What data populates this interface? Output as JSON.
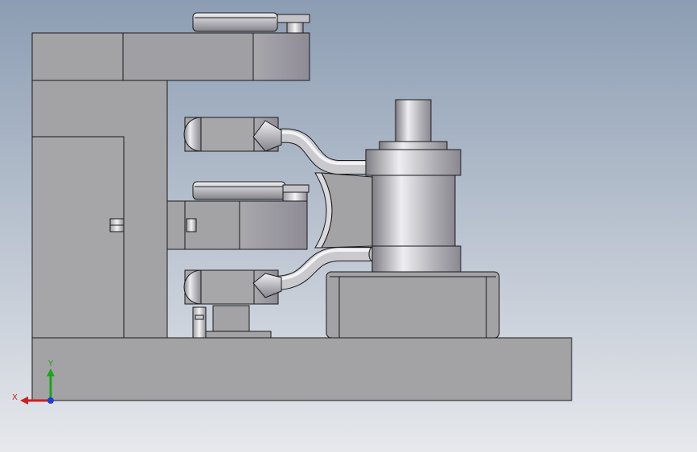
{
  "viewport": {
    "bg_top": "#8c9db3",
    "bg_bottom": "#e6e8ec"
  },
  "triad": {
    "x_label": "X",
    "y_label": "Y",
    "x_color": "#cc1f1f",
    "y_color": "#1aa61a",
    "z_color": "#1f3fd6"
  },
  "model": {
    "part_color": "#a3a3a6",
    "part_dark": "#8e8e92",
    "edge_color": "#1a1a1a",
    "shade_light": "#e8e8ec",
    "shade_dark": "#8f8c96"
  }
}
